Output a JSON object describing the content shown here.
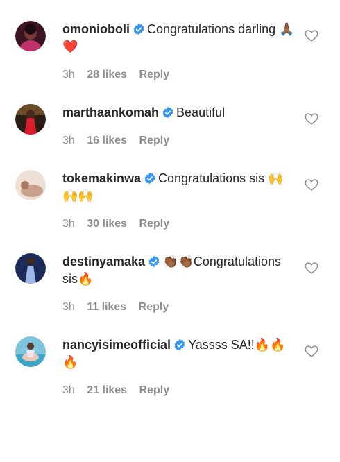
{
  "comments": [
    {
      "username": "omonioboli",
      "text": "Congratulations darling 🙏🏾❤️",
      "time": "3h",
      "likes": "28 likes",
      "reply": "Reply",
      "verified": true,
      "avatar_colors": [
        "#3a1420",
        "#c0306a"
      ]
    },
    {
      "username": "marthaankomah",
      "text": "Beautiful",
      "time": "3h",
      "likes": "16 likes",
      "reply": "Reply",
      "verified": true,
      "avatar_colors": [
        "#2a1d14",
        "#d81e2a"
      ]
    },
    {
      "username": "tokemakinwa",
      "text": "Congratulations sis 🙌🙌🙌",
      "time": "3h",
      "likes": "30 likes",
      "reply": "Reply",
      "verified": true,
      "avatar_colors": [
        "#e8d2c4",
        "#b88870"
      ]
    },
    {
      "username": "destinyamaka",
      "text": "👏🏾👏🏾Congratulations sis🔥",
      "time": "3h",
      "likes": "11 likes",
      "reply": "Reply",
      "verified": true,
      "avatar_colors": [
        "#1d2b5a",
        "#6f8fd8"
      ]
    },
    {
      "username": "nancyisimeofficial",
      "text": "Yassss SA!!🔥🔥🔥",
      "time": "3h",
      "likes": "21 likes",
      "reply": "Reply",
      "verified": true,
      "avatar_colors": [
        "#3aa7c8",
        "#b7d9e6"
      ]
    }
  ],
  "colors": {
    "text": "#262626",
    "meta": "#8e8e8e",
    "verified_badge": "#3897f0",
    "heart_outline": "#8e8e8e"
  },
  "icons": {
    "verified": "verified-badge-icon",
    "like": "heart-outline-icon"
  }
}
